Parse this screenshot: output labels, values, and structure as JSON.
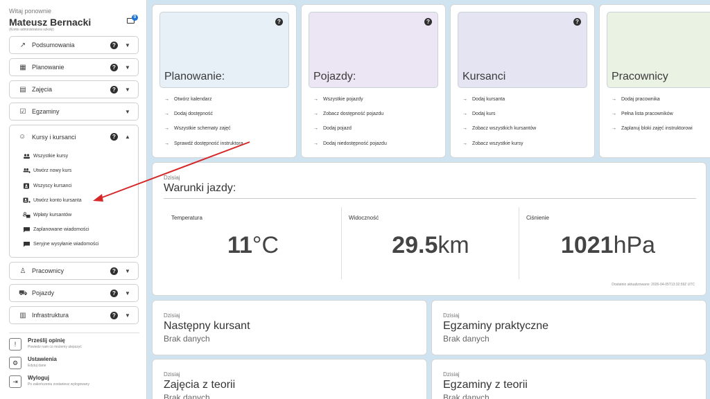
{
  "sidebar": {
    "welcome": "Witaj ponownie",
    "username": "Mateusz Bernacki",
    "account_type": "(Konto administratora szkoły)",
    "messages_badge": "0",
    "menu": [
      {
        "label": "Podsumowania",
        "icon": "trending-up-icon"
      },
      {
        "label": "Planowanie",
        "icon": "calendar-icon"
      },
      {
        "label": "Zajęcia",
        "icon": "clipboard-icon"
      },
      {
        "label": "Egzaminy",
        "icon": "clipboard-check-icon"
      }
    ],
    "expanded": {
      "label": "Kursy i kursanci",
      "items": [
        "Wszystkie kursy",
        "Utwórz nowy kurs",
        "Wszyscy kursanci",
        "Utwórz konto kursanta",
        "Wpłaty kursantów",
        "Zaplanowane wiadomości",
        "Seryjne wysyłanie wiadomości"
      ]
    },
    "menu_bottom": [
      {
        "label": "Pracownicy",
        "icon": "person-icon"
      },
      {
        "label": "Pojazdy",
        "icon": "car-icon"
      },
      {
        "label": "Infrastruktura",
        "icon": "building-icon"
      }
    ],
    "footer": [
      {
        "title": "Prześlij opinię",
        "subtitle": "Powiedz nam co możemy ulepszyć"
      },
      {
        "title": "Ustawienia",
        "subtitle": "Edytuj dane"
      },
      {
        "title": "Wyloguj",
        "subtitle": "Po zakończeniu zostaniesz wylogowany"
      }
    ]
  },
  "quick": [
    {
      "title": "Planowanie:",
      "color": "#e6f0f6",
      "links": [
        "Otwórz kalendarz",
        "Dodaj dostępność",
        "Wszystkie schematy zajęć",
        "Sprawdź dostępność instruktora"
      ]
    },
    {
      "title": "Pojazdy:",
      "color": "#ece6f4",
      "links": [
        "Wszystkie pojazdy",
        "Zobacz dostępność pojazdu",
        "Dodaj pojazd",
        "Dodaj niedostępność pojazdu"
      ]
    },
    {
      "title": "Kursanci",
      "color": "#e4e4f2",
      "links": [
        "Dodaj kursanta",
        "Dodaj kurs",
        "Zobacz wszystkich kursantów",
        "Zobacz wszystkie kursy"
      ]
    },
    {
      "title": "Pracownicy",
      "color": "#eaf2e3",
      "links": [
        "Dodaj pracownika",
        "Pełna lista pracowników",
        "Zaplanuj bloki zajęć instruktorowi"
      ]
    }
  ],
  "weather": {
    "today": "Dzisiaj",
    "title": "Warunki jazdy:",
    "metrics": [
      {
        "label": "Temperatura",
        "value": "11",
        "unit": "°C"
      },
      {
        "label": "Widoczność",
        "value": "29.5",
        "unit": "km"
      },
      {
        "label": "Ciśnienie",
        "value": "1021",
        "unit": "hPa"
      }
    ],
    "updated": "Dostatnio aktualizowano: 2026-04-05T13:32:59Z UTC"
  },
  "info": [
    {
      "today": "Dzisiaj",
      "title": "Następny kursant",
      "value": "Brak danych"
    },
    {
      "today": "Dzisiaj",
      "title": "Egzaminy praktyczne",
      "value": "Brak danych"
    },
    {
      "today": "Dzisiaj",
      "title": "Zajęcia z teorii",
      "value": "Brak danych"
    },
    {
      "today": "Dzisiaj",
      "title": "Egzaminy z teorii",
      "value": "Brak danych"
    }
  ],
  "colors": {
    "accent": "#1e73d6",
    "annotation_arrow": "#d62828",
    "background": "#cfe3f1"
  }
}
